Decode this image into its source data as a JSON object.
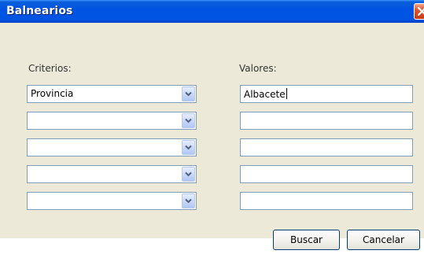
{
  "window": {
    "title": "Balnearios",
    "close_icon": "close-icon"
  },
  "form": {
    "criteria_label": "Criterios:",
    "values_label": "Valores:",
    "rows": [
      {
        "criterion": "Provincia",
        "value": "Albacete"
      },
      {
        "criterion": "",
        "value": ""
      },
      {
        "criterion": "",
        "value": ""
      },
      {
        "criterion": "",
        "value": ""
      },
      {
        "criterion": "",
        "value": ""
      }
    ]
  },
  "buttons": {
    "search_label": "Buscar",
    "cancel_label": "Cancelar"
  },
  "colors": {
    "titlebar": "#0054e3",
    "window_background": "#ece9d8",
    "field_border": "#7f9db9"
  }
}
